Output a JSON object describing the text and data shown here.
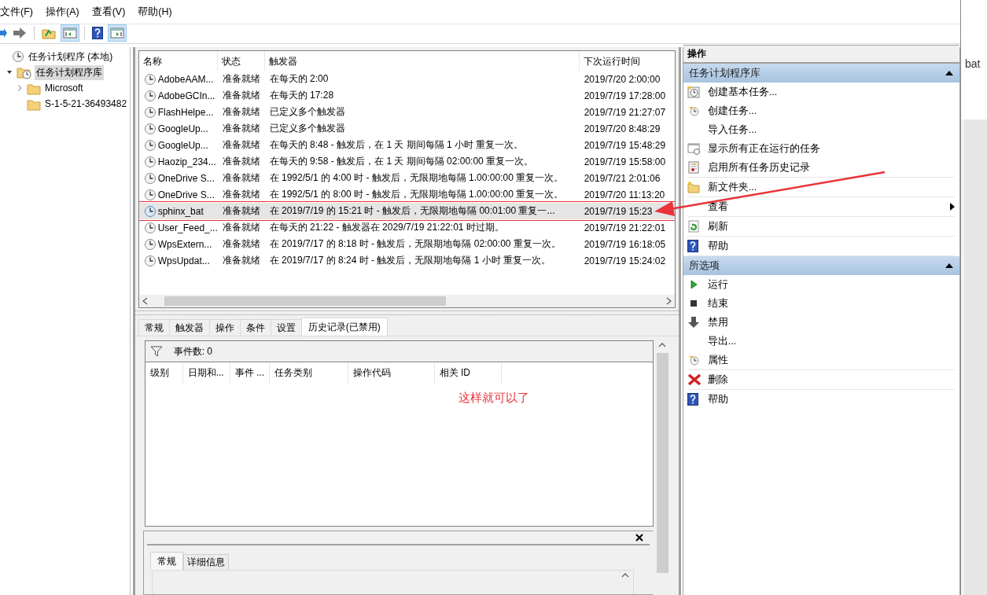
{
  "menu": [
    "文件(F)",
    "操作(A)",
    "查看(V)",
    "帮助(H)"
  ],
  "toolbar": [
    {
      "on": false
    },
    {
      "on": false
    },
    {
      "on": false
    },
    {
      "on": true
    },
    {
      "on": false
    },
    {
      "on": true
    }
  ],
  "tree": [
    {
      "label": "任务计划程序 (本地)",
      "selected": false,
      "children": [
        {
          "label": "任务计划程序库",
          "selected": true,
          "expanded": true,
          "children": [
            {
              "label": "Microsoft",
              "selected": false,
              "expanded": false
            },
            {
              "label": "S-1-5-21-36493482",
              "selected": false
            }
          ]
        }
      ]
    }
  ],
  "tasks": {
    "columns": [
      "名称",
      "状态",
      "触发器",
      "下次运行时间"
    ],
    "rows": [
      {
        "name": "AdobeAAM...",
        "status": "准备就绪",
        "trigger": "在每天的 2:00",
        "next_run": "2019/7/20 2:00:00",
        "selected": false,
        "framed": false
      },
      {
        "name": "AdobeGCIn...",
        "status": "准备就绪",
        "trigger": "在每天的 17:28",
        "next_run": "2019/7/19 17:28:00",
        "selected": false,
        "framed": false
      },
      {
        "name": "FlashHelpe...",
        "status": "准备就绪",
        "trigger": "已定义多个触发器",
        "next_run": "2019/7/19 21:27:07",
        "selected": false,
        "framed": false
      },
      {
        "name": "GoogleUp...",
        "status": "准备就绪",
        "trigger": "已定义多个触发器",
        "next_run": "2019/7/20 8:48:29",
        "selected": false,
        "framed": false
      },
      {
        "name": "GoogleUp...",
        "status": "准备就绪",
        "trigger": "在每天的 8:48 - 触发后，在 1 天 期间每隔 1 小时 重复一次。",
        "next_run": "2019/7/19 15:48:29",
        "selected": false,
        "framed": false
      },
      {
        "name": "Haozip_234...",
        "status": "准备就绪",
        "trigger": "在每天的 9:58 - 触发后，在 1 天 期间每隔 02:00:00 重复一次。",
        "next_run": "2019/7/19 15:58:00",
        "selected": false,
        "framed": false
      },
      {
        "name": "OneDrive S...",
        "status": "准备就绪",
        "trigger": "在 1992/5/1 的 4:00 时 - 触发后，无限期地每隔 1.00:00:00 重复一次。",
        "next_run": "2019/7/21 2:01:06",
        "selected": false,
        "framed": false
      },
      {
        "name": "OneDrive S...",
        "status": "准备就绪",
        "trigger": "在 1992/5/1 的 8:00 时 - 触发后，无限期地每隔 1.00:00:00 重复一次。",
        "next_run": "2019/7/20 11:13:20",
        "selected": false,
        "framed": false
      },
      {
        "name": "sphinx_bat",
        "status": "准备就绪",
        "trigger": "在 2019/7/19 的 15:21 时 - 触发后，无限期地每隔 00:01:00 重复一...",
        "next_run": "2019/7/19 15:23",
        "selected": true,
        "framed": true
      },
      {
        "name": "User_Feed_...",
        "status": "准备就绪",
        "trigger": "在每天的 21:22 - 触发器在 2029/7/19 21:22:01 时过期。",
        "next_run": "2019/7/19 21:22:01",
        "selected": false,
        "framed": false
      },
      {
        "name": "WpsExtern...",
        "status": "准备就绪",
        "trigger": "在 2019/7/17 的 8:18 时 - 触发后，无限期地每隔 02:00:00 重复一次。",
        "next_run": "2019/7/19 16:18:05",
        "selected": false,
        "framed": false
      },
      {
        "name": "WpsUpdat...",
        "status": "准备就绪",
        "trigger": "在 2019/7/17 的 8:24 时 - 触发后，无限期地每隔 1 小时 重复一次。",
        "next_run": "2019/7/19 15:24:02",
        "selected": false,
        "framed": false
      }
    ]
  },
  "detail_tabs": [
    {
      "label": "常规",
      "selected": false
    },
    {
      "label": "触发器",
      "selected": false
    },
    {
      "label": "操作",
      "selected": false
    },
    {
      "label": "条件",
      "selected": false
    },
    {
      "label": "设置",
      "selected": false
    },
    {
      "label": "历史记录(已禁用)",
      "selected": true
    }
  ],
  "history": {
    "event_count": "事件数: 0",
    "columns": [
      "级别",
      "日期和...",
      "事件 ...",
      "任务类别",
      "操作代码",
      "相关 ID"
    ]
  },
  "annotation": "这样就可以了",
  "event_tabs": [
    {
      "label": "常规",
      "selected": true
    },
    {
      "label": "详细信息",
      "selected": false
    }
  ],
  "actions": {
    "title": "操作",
    "sections": [
      {
        "title": "任务计划程序库",
        "expanded": true,
        "groups": [
          [
            {
              "label": "创建基本任务...",
              "submenu": false
            },
            {
              "label": "创建任务...",
              "submenu": false
            },
            {
              "label": "导入任务...",
              "submenu": false
            },
            {
              "label": "显示所有正在运行的任务",
              "submenu": false
            },
            {
              "label": "启用所有任务历史记录",
              "submenu": false
            }
          ],
          [
            {
              "label": "新文件夹...",
              "submenu": false
            }
          ],
          [
            {
              "label": "查看",
              "submenu": true
            }
          ],
          [
            {
              "label": "刷新",
              "submenu": false
            }
          ],
          [
            {
              "label": "帮助",
              "submenu": false
            }
          ]
        ]
      },
      {
        "title": "所选项",
        "expanded": true,
        "groups": [
          [
            {
              "label": "运行",
              "submenu": false
            },
            {
              "label": "结束",
              "submenu": false
            },
            {
              "label": "禁用",
              "submenu": false
            },
            {
              "label": "导出...",
              "submenu": false
            },
            {
              "label": "属性",
              "submenu": false
            }
          ],
          [
            {
              "label": "删除",
              "submenu": false
            }
          ],
          [
            {
              "label": "帮助",
              "submenu": false
            }
          ]
        ]
      }
    ]
  },
  "background_window": {
    "text": "bat"
  }
}
